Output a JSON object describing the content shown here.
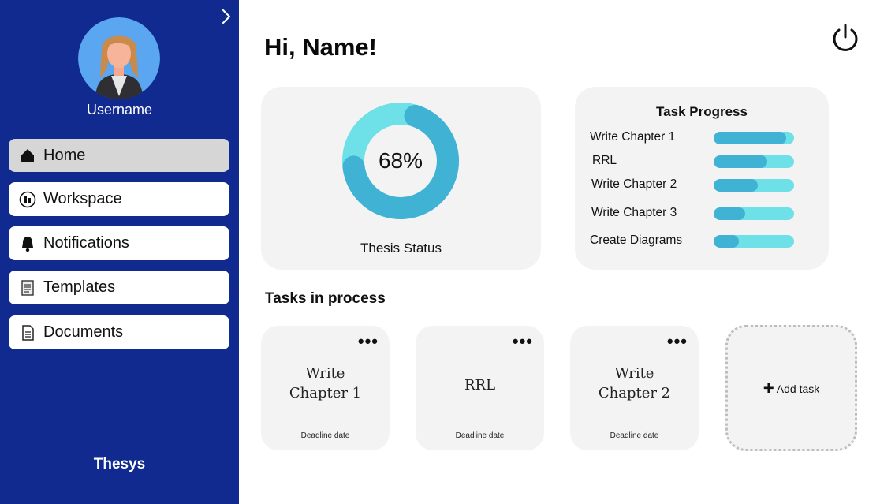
{
  "sidebar": {
    "username": "Username",
    "brand": "Thesys",
    "items": [
      {
        "label": "Home",
        "icon": "home-icon",
        "active": true
      },
      {
        "label": "Workspace",
        "icon": "workspace-icon",
        "active": false
      },
      {
        "label": "Notifications",
        "icon": "bell-icon",
        "active": false
      },
      {
        "label": "Templates",
        "icon": "templates-icon",
        "active": false
      },
      {
        "label": "Documents",
        "icon": "document-icon",
        "active": false
      }
    ]
  },
  "header": {
    "greeting": "Hi, Name!"
  },
  "thesis_status": {
    "percent_label": "68%",
    "percent": 68,
    "label": "Thesis Status"
  },
  "task_progress": {
    "title": "Task Progress",
    "tasks": [
      {
        "label": "Write Chapter 1",
        "progress": 0.9
      },
      {
        "label": "RRL",
        "progress": 0.67
      },
      {
        "label": "Write Chapter 2",
        "progress": 0.55
      },
      {
        "label": "Write Chapter 3",
        "progress": 0.39
      },
      {
        "label": "Create Diagrams",
        "progress": 0.31
      }
    ]
  },
  "tasks_in_process": {
    "title": "Tasks in process",
    "cards": [
      {
        "name": "Write\nChapter 1",
        "deadline": "Deadline date"
      },
      {
        "name": "RRL",
        "deadline": "Deadline date"
      },
      {
        "name": "Write\nChapter 2",
        "deadline": "Deadline date"
      }
    ],
    "add_label": "Add task"
  },
  "colors": {
    "sidebar": "#112a8f",
    "donut_track": "#6ee0e8",
    "donut_fill": "#40b3d4",
    "card": "#f3f3f3"
  }
}
